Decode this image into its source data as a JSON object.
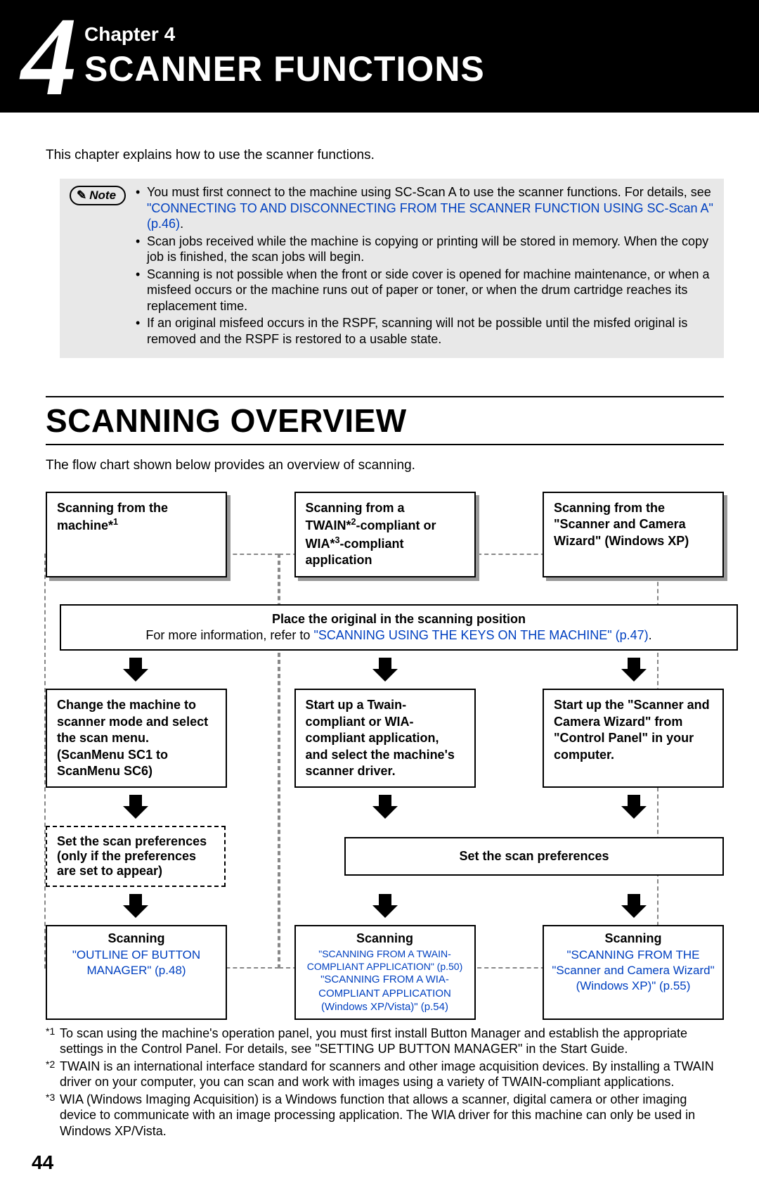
{
  "chapter": {
    "number": "4",
    "label": "Chapter 4",
    "title": "SCANNER FUNCTIONS"
  },
  "intro": "This chapter explains how to use the scanner functions.",
  "note_label": "Note",
  "notes": {
    "n1a": "You must first connect to the machine using SC-Scan A to use the scanner functions. For details, see ",
    "n1link": "\"CONNECTING TO AND DISCONNECTING FROM THE SCANNER FUNCTION USING SC-Scan A\" (p.46)",
    "n1b": ".",
    "n2": "Scan jobs received while the machine is copying or printing will be stored in memory. When the copy job is finished, the scan jobs will begin.",
    "n3": "Scanning is not possible when the front or side cover is opened for machine maintenance, or when a misfeed occurs or the machine runs out of paper or toner, or when the drum cartridge reaches its replacement time.",
    "n4": "If an original misfeed occurs in the RSPF, scanning will not be possible until the misfed original is removed and the RSPF is restored to a usable state."
  },
  "section_title": "SCANNING OVERVIEW",
  "flow_intro": "The flow chart shown below provides an overview of scanning.",
  "top": {
    "b1_pre": "Scanning from the machine*",
    "b1_sup": "1",
    "b2_l1": "Scanning from a",
    "b2_l2a": "TWAIN*",
    "b2_sup2": "2",
    "b2_l2b": "-compliant or",
    "b2_l3a": "WIA*",
    "b2_sup3": "3",
    "b2_l3b": "-compliant application",
    "b3": "Scanning from the \"Scanner and Camera Wizard\" (Windows XP)"
  },
  "place": {
    "title": "Place the original in the scanning position",
    "text_a": "For more information, refer to ",
    "link": "\"SCANNING USING THE KEYS ON THE MACHINE\" (p.47)",
    "text_b": "."
  },
  "midrow": {
    "m1": "Change the machine to scanner mode and select the scan menu. (ScanMenu SC1 to ScanMenu SC6)",
    "m2": "Start up a Twain-compliant or WIA-compliant application, and select the machine's scanner driver.",
    "m3": "Start up the \"Scanner and Camera Wizard\" from \"Control Panel\" in your computer."
  },
  "prefs": {
    "p1": "Set the scan preferences (only if the preferences are set to appear)",
    "p2": "Set the scan preferences"
  },
  "scan": {
    "title": "Scanning",
    "s1": "\"OUTLINE OF BUTTON MANAGER\" (p.48)",
    "s2a": "\"SCANNING FROM A TWAIN-COMPLIANT APPLICATION\" (p.50)",
    "s2b": "\"SCANNING FROM A WIA-COMPLIANT APPLICATION (Windows XP/Vista)\" (p.54)",
    "s3": "\"SCANNING FROM THE \"Scanner and Camera Wizard\" (Windows XP)\" (p.55)"
  },
  "foot": {
    "f1m": "*1",
    "f1": "To scan using the machine's operation panel, you must first install Button Manager and establish the appropriate settings in the Control Panel. For details, see \"SETTING UP BUTTON MANAGER\" in the Start Guide.",
    "f2m": "*2",
    "f2": "TWAIN is an international interface standard for scanners and other image acquisition devices. By installing a TWAIN driver on your computer, you can scan and work with images using a variety of TWAIN-compliant applications.",
    "f3m": "*3",
    "f3": "WIA (Windows Imaging Acquisition) is a Windows function that allows a scanner, digital camera or other imaging device to communicate with an image processing application. The WIA driver for this machine can only be used in Windows XP/Vista."
  },
  "page": "44"
}
